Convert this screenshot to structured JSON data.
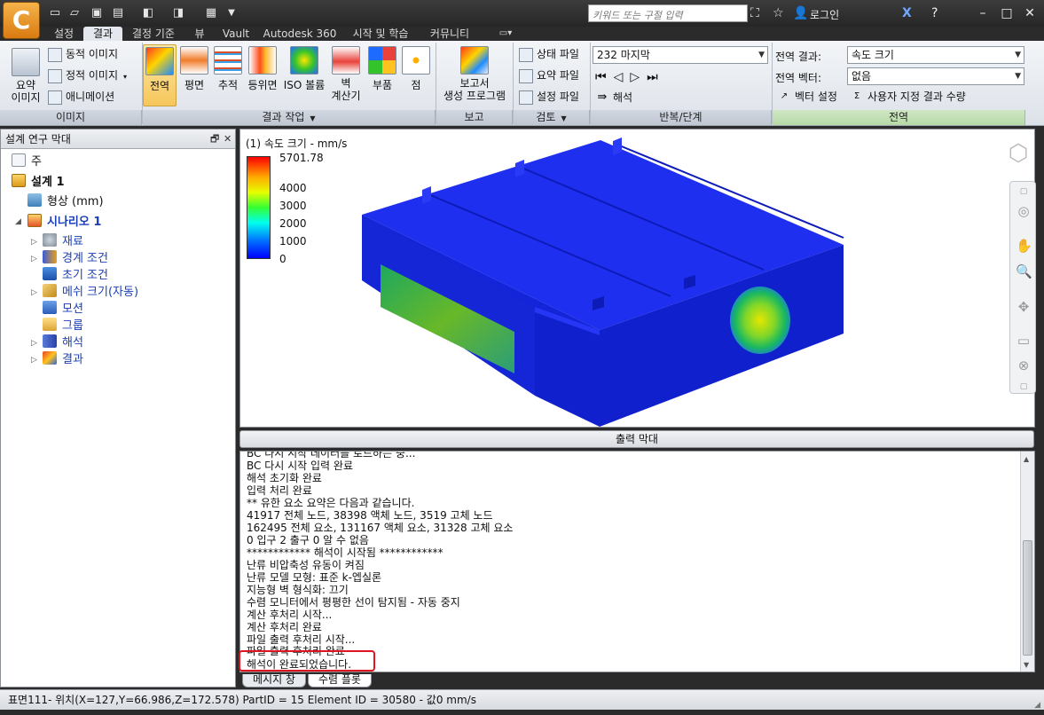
{
  "app": {
    "logo_glyph": "C",
    "search_placeholder": "키워드 또는 구절 입력",
    "login_label": "로그인"
  },
  "tabs": [
    "설정",
    "결과",
    "결정 기준",
    "뷰",
    "Vault",
    "Autodesk 360",
    "시작 및 학습",
    "커뮤니티"
  ],
  "active_tab": "결과",
  "ribbon": {
    "image_panel": {
      "title": "이미지",
      "summary_image": "요약\n이미지",
      "dynamic_image": "동적 이미지",
      "static_image": "정적 이미지",
      "animation": "애니메이션"
    },
    "result_tasks": {
      "title": "결과 작업",
      "buttons": [
        {
          "label": "전역",
          "icon": "global-result-icon"
        },
        {
          "label": "평면",
          "icon": "plane-icon"
        },
        {
          "label": "추적",
          "icon": "trace-icon"
        },
        {
          "label": "등위면",
          "icon": "isosurface-icon"
        },
        {
          "label": "ISO 볼륨",
          "icon": "iso-volume-icon"
        },
        {
          "label": "벽\n계산기",
          "icon": "wall-calculator-icon"
        },
        {
          "label": "부품",
          "icon": "part-icon"
        },
        {
          "label": "점",
          "icon": "point-icon"
        }
      ]
    },
    "report_panel": {
      "title": "보고",
      "button": "보고서\n생성 프로그램"
    },
    "review_panel": {
      "title": "검토",
      "status_file": "상태 파일",
      "summary_file": "요약 파일",
      "settings_file": "설정 파일"
    },
    "iteration_panel": {
      "title": "반복/단계",
      "step_value": "232 마지막",
      "analysis_label": "해석"
    },
    "global_panel": {
      "title": "전역",
      "result_label": "전역 결과:",
      "result_value": "속도 크기",
      "vector_label": "전역 벡터:",
      "vector_value": "없음",
      "vector_settings": "벡터 설정",
      "custom_quantity": "사용자 지정 결과 수량"
    }
  },
  "left_panel": {
    "title": "설계 연구 막대",
    "tree": [
      {
        "label": "주",
        "icon": "document-icon"
      },
      {
        "label": "설계 1",
        "icon": "design-icon"
      },
      {
        "label": "형상 (mm)",
        "icon": "geometry-icon"
      },
      {
        "label": "시나리오 1",
        "icon": "scenario-icon"
      },
      {
        "label": "재료",
        "icon": "materials-icon"
      },
      {
        "label": "경계 조건",
        "icon": "boundary-icon"
      },
      {
        "label": "초기 조건",
        "icon": "initial-condition-icon"
      },
      {
        "label": "메쉬 크기(자동)",
        "icon": "mesh-icon"
      },
      {
        "label": "모션",
        "icon": "motion-icon"
      },
      {
        "label": "그룹",
        "icon": "group-icon"
      },
      {
        "label": "해석",
        "icon": "solve-icon"
      },
      {
        "label": "결과",
        "icon": "results-icon"
      }
    ]
  },
  "viewport": {
    "result_title": "(1) 속도 크기 - mm/s",
    "legend_ticks": [
      "5701.78",
      "4000",
      "3000",
      "2000",
      "1000",
      "0"
    ]
  },
  "output": {
    "title": "출력 막대",
    "lines": [
      "BC 다시 시작 데이터를 로드하는 중...",
      "BC 다시 시작 입력 완료",
      "해석 초기화 완료",
      "입력 처리 완료",
      "** 유한 요소 요약은 다음과 같습니다.",
      "41917 전체 노드,   38398 액체 노드,   3519 고체 노드",
      "162495 전체 요소, 131167 액체 요소,   31328 고체 요소",
      "0 입구    2 출구    0 알 수 없음",
      "************ 해석이 시작됨 ************",
      "난류 비압축성 유동이 켜짐",
      "난류 모델 모형: 표준 k-엡실론",
      "지능형 벽 형식화: 끄기",
      "수렴 모니터에서 평평한 선이 탐지됨 - 자동 중지",
      "계산 후처리 시작...",
      "계산 후처리 완료",
      "파일 출력 후처리 시작...",
      "파일 출력 후처리 완료",
      "해석이 완료되었습니다."
    ],
    "tabs": [
      "메시지 창",
      "수렴 플롯"
    ],
    "highlight_color": "#e0141e"
  },
  "status_bar": {
    "text": "표면111- 위치(X=127,Y=66.986,Z=172.578) PartID = 15 Element ID = 30580 - 값0  mm/s"
  },
  "colors": {
    "accent_active": "#f6c65b",
    "model_blue": "#0a1fd6",
    "panel_green": "#b6d9a6"
  }
}
